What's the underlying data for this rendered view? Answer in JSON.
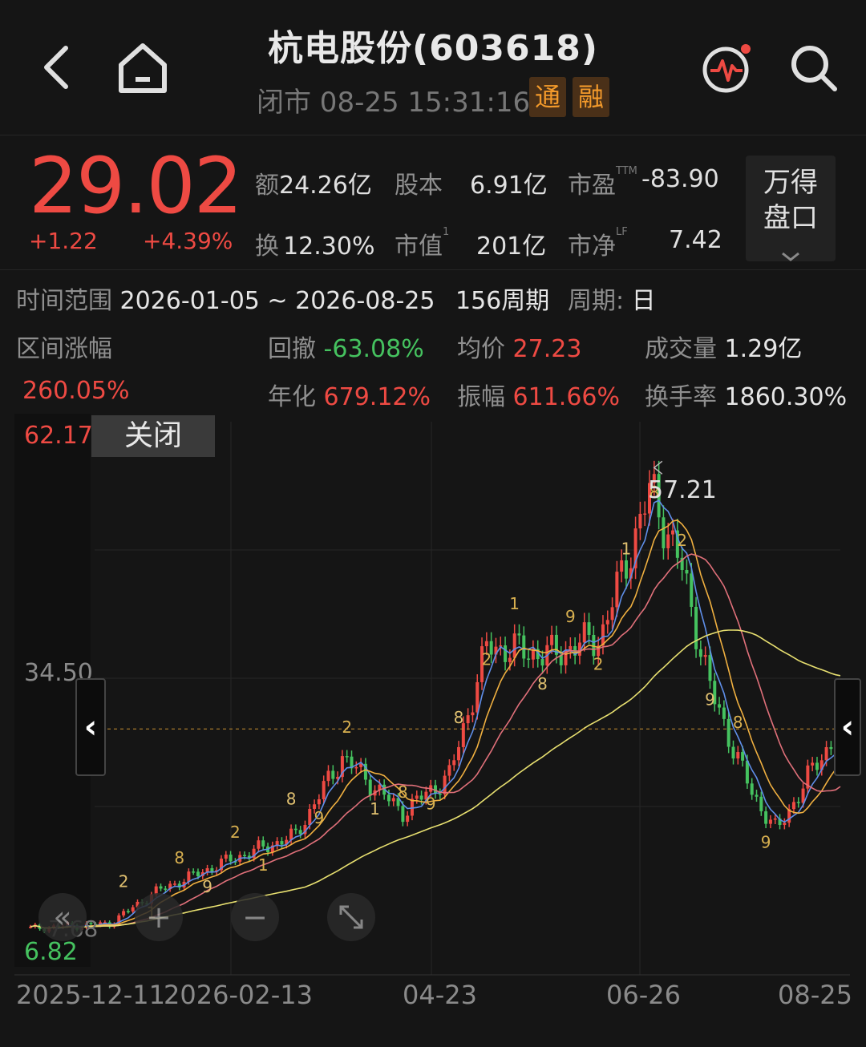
{
  "header": {
    "back_icon": "chevron-left-icon",
    "home_icon": "home-icon",
    "title": "杭电股份(603618)",
    "status": "闭市 08-25 15:31:16",
    "tags": [
      "通",
      "融"
    ],
    "alert_icon": "pulse-alert-icon",
    "search_icon": "search-icon"
  },
  "quote": {
    "price": "29.02",
    "change": "+1.22",
    "change_pct": "+4.39%",
    "stats": [
      {
        "label": "额",
        "value": "24.26亿"
      },
      {
        "label": "股本",
        "value": "6.91亿"
      },
      {
        "label": "市盈",
        "sup": "TTM",
        "value": "-83.90"
      },
      {
        "label": "换",
        "value": "12.30%"
      },
      {
        "label": "市值",
        "sup": "1",
        "value": "201亿"
      },
      {
        "label": "市净",
        "sup": "LF",
        "value": "7.42"
      }
    ],
    "wande_label_1": "万得",
    "wande_label_2": "盘口"
  },
  "interval": {
    "range_label": "时间范围",
    "range_value": "2026-01-05 ~ 2026-08-25",
    "periods": "156周期",
    "period_label": "周期:",
    "period_value": "日",
    "gain_label": "区间涨幅",
    "gain_value": "260.05%",
    "drawdown_label": "回撤",
    "drawdown_value": "-63.08%",
    "avg_label": "均价",
    "avg_value": "27.23",
    "volume_label": "成交量",
    "volume_value": "1.29亿",
    "annual_label": "年化",
    "annual_value": "679.12%",
    "amplitude_label": "振幅",
    "amplitude_value": "611.66%",
    "turnover_label": "换手率",
    "turnover_value": "1860.30%"
  },
  "chart": {
    "close_button": "关闭",
    "y_top": "62.17",
    "y_mid": "34.50",
    "y_bottom": "6.82",
    "y_left_value": "7.68",
    "high_label": "57.21",
    "x_labels": [
      "2025-12-11",
      "2026-02-13",
      "04-23",
      "06-26",
      "08-25"
    ],
    "nine_markers": [
      "2",
      "1",
      "8",
      "9",
      "2",
      "1",
      "8",
      "9",
      "2",
      "1",
      "8",
      "9",
      "8",
      "2",
      "1",
      "8",
      "9",
      "2",
      "1",
      "8",
      "2",
      "9",
      "8",
      "9"
    ],
    "colors": {
      "up": "#ee4a43",
      "down": "#45c25f",
      "ma5": "#5f8ee8",
      "ma10": "#f0b040",
      "ma20": "#e0707a",
      "ma60": "#e8e070"
    }
  },
  "chart_data": {
    "type": "candlestick",
    "y_range": [
      6.82,
      62.17
    ],
    "high": 57.21,
    "low": 6.82,
    "last_close": 29.02,
    "x_labels": [
      "2025-12-11",
      "2026-02-13",
      "04-23",
      "06-26",
      "08-25"
    ],
    "approx_close_path": [
      {
        "x": "2025-12-11",
        "y": 7.5
      },
      {
        "x": "2026-01-05",
        "y": 8.0
      },
      {
        "x": "2026-01-20",
        "y": 11.5
      },
      {
        "x": "2026-02-13",
        "y": 15.0
      },
      {
        "x": "2026-03-05",
        "y": 17.5
      },
      {
        "x": "2026-03-20",
        "y": 26.0
      },
      {
        "x": "2026-04-08",
        "y": 20.0
      },
      {
        "x": "2026-04-23",
        "y": 24.0
      },
      {
        "x": "2026-05-05",
        "y": 38.0
      },
      {
        "x": "2026-05-25",
        "y": 37.0
      },
      {
        "x": "2026-06-10",
        "y": 39.0
      },
      {
        "x": "2026-06-26",
        "y": 55.0
      },
      {
        "x": "2026-07-06",
        "y": 46.0
      },
      {
        "x": "2026-07-15",
        "y": 33.0
      },
      {
        "x": "2026-07-28",
        "y": 22.0
      },
      {
        "x": "2026-08-05",
        "y": 18.0
      },
      {
        "x": "2026-08-15",
        "y": 24.0
      },
      {
        "x": "2026-08-25",
        "y": 29.02
      }
    ]
  }
}
